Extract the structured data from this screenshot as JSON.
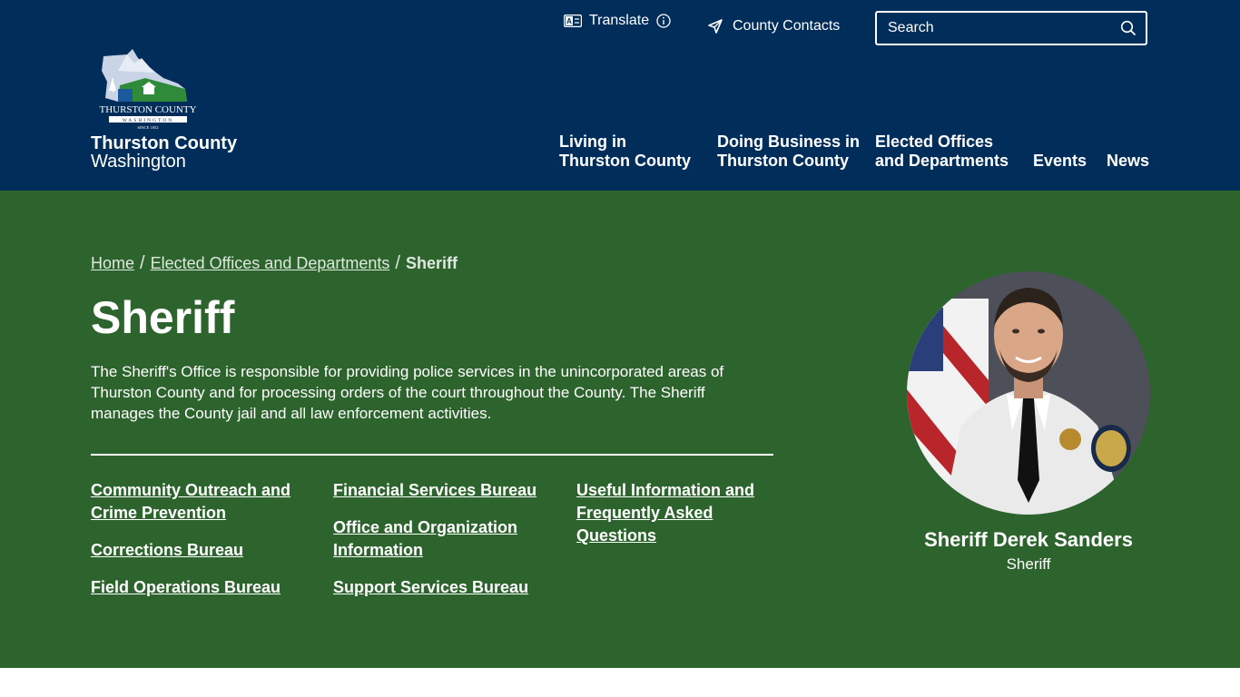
{
  "header": {
    "brand_name": "Thurston County",
    "brand_sub": "Washington",
    "logo": {
      "name": "THURSTON COUNTY",
      "state": "WASHINGTON",
      "since": "SINCE 1852"
    },
    "translate_label": "Translate",
    "contacts_label": "County Contacts",
    "search_placeholder": "Search",
    "nav": [
      {
        "line1": "Living in",
        "line2": "Thurston County"
      },
      {
        "line1": "Doing Business in",
        "line2": "Thurston County"
      },
      {
        "line1": "Elected Offices",
        "line2": "and Departments"
      },
      {
        "line1": "",
        "line2": "Events"
      },
      {
        "line1": "",
        "line2": "News"
      }
    ]
  },
  "breadcrumb": {
    "home": "Home",
    "parent": "Elected Offices and Departments",
    "current": "Sheriff"
  },
  "page": {
    "title": "Sheriff",
    "intro": "The Sheriff's Office is responsible for providing police services in the unincorporated areas of Thurston County and for processing orders of the court throughout the County. The Sheriff manages the County jail and all law enforcement activities."
  },
  "links": {
    "col1": [
      "Community Outreach and Crime Prevention",
      "Corrections Bureau",
      "Field Operations Bureau"
    ],
    "col2": [
      "Financial Services Bureau",
      "Office and Organization Information",
      "Support Services Bureau"
    ],
    "col3": [
      "Useful Information and Frequently Asked Questions"
    ]
  },
  "official": {
    "name": "Sheriff Derek Sanders",
    "role": "Sheriff"
  },
  "colors": {
    "header_bg": "#002d5a",
    "hero_bg": "#2d632d"
  }
}
